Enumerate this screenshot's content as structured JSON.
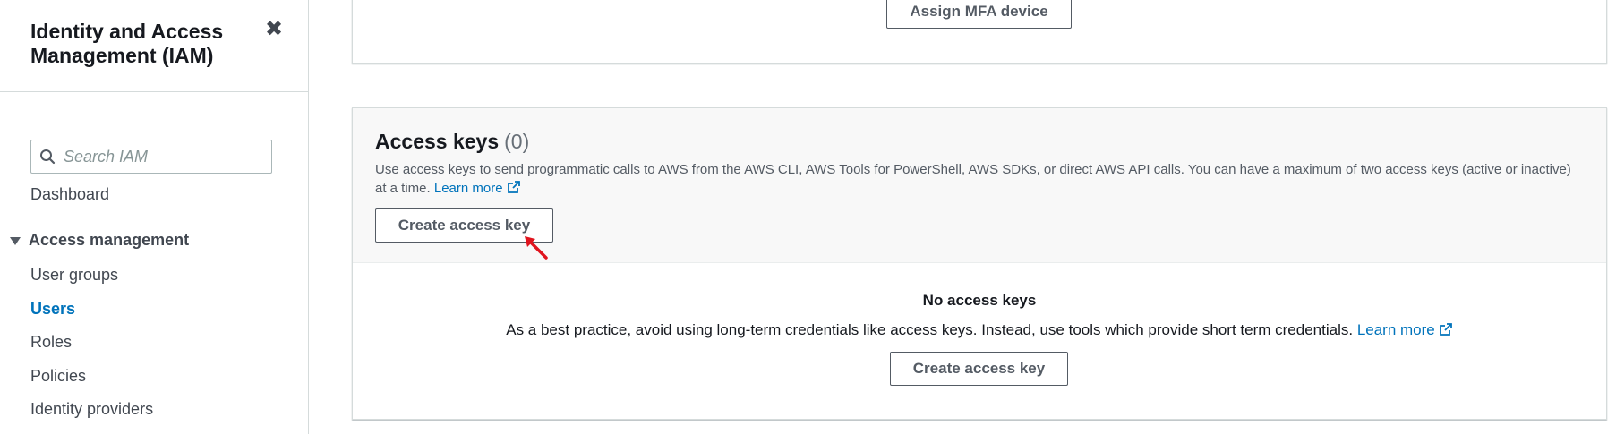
{
  "sidebar": {
    "title": "Identity and Access Management (IAM)",
    "close_icon": "close-icon",
    "search_placeholder": "Search IAM",
    "dashboard_label": "Dashboard",
    "section_label": "Access management",
    "items": [
      {
        "label": "User groups",
        "active": false
      },
      {
        "label": "Users",
        "active": true
      },
      {
        "label": "Roles",
        "active": false
      },
      {
        "label": "Policies",
        "active": false
      },
      {
        "label": "Identity providers",
        "active": false
      }
    ]
  },
  "mfa": {
    "button_label": "Assign MFA device"
  },
  "access_keys": {
    "title": "Access keys",
    "count": "(0)",
    "description": "Use access keys to send programmatic calls to AWS from the AWS CLI, AWS Tools for PowerShell, AWS SDKs, or direct AWS API calls. You can have a maximum of two access keys (active or inactive) at a time.",
    "learn_more_label": "Learn more",
    "create_button_label": "Create access key",
    "empty_title": "No access keys",
    "empty_description": "As a best practice, avoid using long-term credentials like access keys. Instead, use tools which provide short term credentials.",
    "empty_learn_more_label": "Learn more",
    "empty_create_button_label": "Create access key"
  },
  "colors": {
    "link": "#0073bb",
    "text": "#16191f",
    "border": "#d5dbdb",
    "cursor": "#e0141e"
  }
}
